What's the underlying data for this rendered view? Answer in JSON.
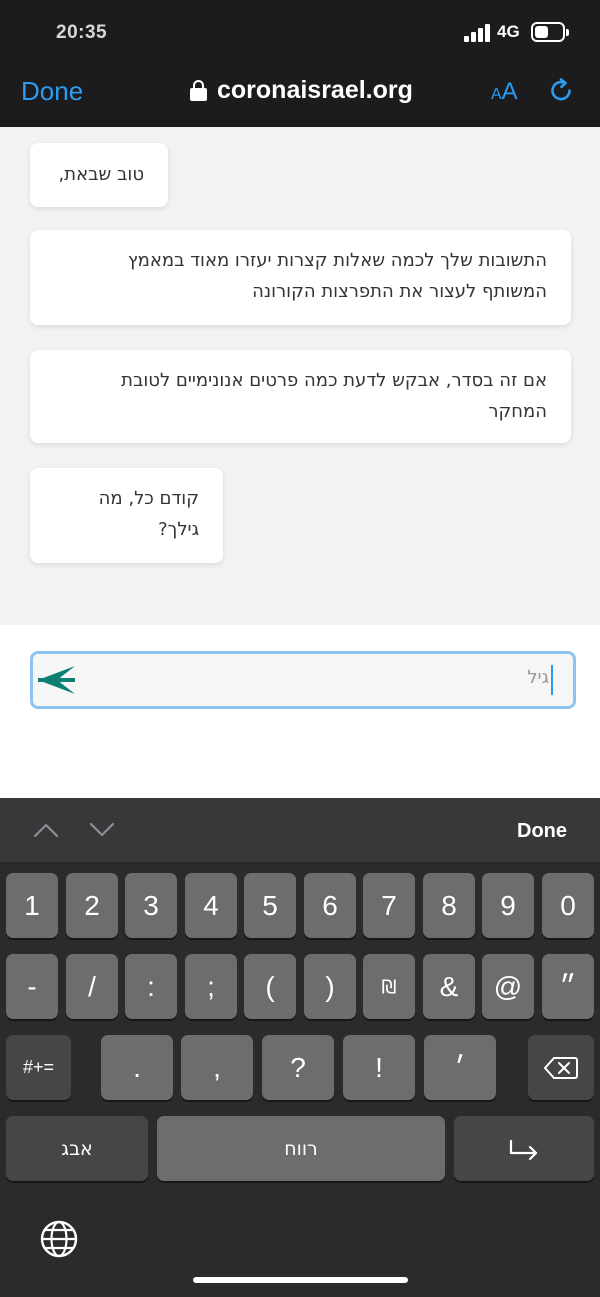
{
  "status_bar": {
    "time": "20:35",
    "network": "4G"
  },
  "browser": {
    "done_label": "Done",
    "url": "coronaisrael.org",
    "text_size_small": "A",
    "text_size_large": "A"
  },
  "chat": {
    "messages": [
      {
        "line1": "טוב שבאת,",
        "line2": ""
      },
      {
        "line1": "התשובות שלך לכמה שאלות קצרות יעזרו מאוד במאמץ",
        "line2": "המשותף לעצור את התפרצות הקורונה"
      },
      {
        "line1": "אם זה בסדר, אבקש לדעת כמה פרטים אנונימיים לטובת",
        "line2": "המחקר"
      },
      {
        "line1": "קודם כל, מה",
        "line2": "גילך?"
      }
    ],
    "input": {
      "placeholder": "גיל",
      "value": ""
    },
    "send_color": "#0e7f73"
  },
  "keyboard": {
    "done_label": "Done",
    "row1": [
      "1",
      "2",
      "3",
      "4",
      "5",
      "6",
      "7",
      "8",
      "9",
      "0"
    ],
    "row2": [
      "-",
      "/",
      ":",
      ";",
      "(",
      ")",
      "₪",
      "&",
      "@",
      "״"
    ],
    "row3": [
      ".",
      ",",
      "?",
      "!",
      "׳"
    ],
    "symbols_label": "#+=",
    "letters_label": "אבג",
    "space_label": "רווח"
  }
}
